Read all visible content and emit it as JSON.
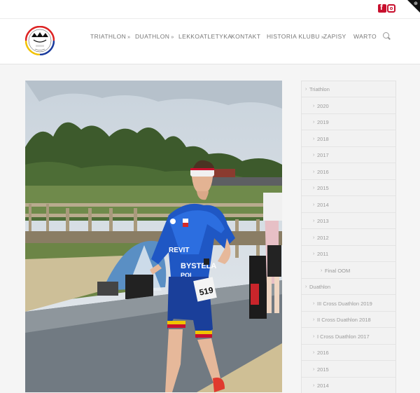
{
  "colors": {
    "brand_red": "#c8102e",
    "nav_text": "#777777",
    "sidebar_text": "#9a9a9a"
  },
  "social": [
    {
      "name": "facebook-icon",
      "glyph": "f"
    },
    {
      "name": "instagram-icon"
    }
  ],
  "corner_badge": {
    "glyph": "⊕"
  },
  "logo": {
    "alt": "Klub logo"
  },
  "nav": {
    "items": [
      {
        "label": "TRIATHLON",
        "has_dropdown": true,
        "chevron": "»"
      },
      {
        "label": "DUATHLON",
        "has_dropdown": true,
        "chevron": "»"
      },
      {
        "label": "LEKKOATLETYKA",
        "has_dropdown": false
      },
      {
        "label": "KONTAKT",
        "has_dropdown": false
      },
      {
        "label": "HISTORIA KLUBU",
        "has_dropdown": true,
        "chevron": "»"
      },
      {
        "label": "ZAPISY",
        "has_dropdown": false
      },
      {
        "label": "WARTO",
        "has_dropdown": false
      }
    ]
  },
  "photo": {
    "bib_number": "519",
    "jersey_text_1": "REVIT",
    "jersey_text_2": "BYSTELA",
    "jersey_text_3": "POL"
  },
  "sidebar": {
    "arrow": "›",
    "items": [
      {
        "label": "Triathlon",
        "level": 0
      },
      {
        "label": "2020",
        "level": 1
      },
      {
        "label": "2019",
        "level": 1
      },
      {
        "label": "2018",
        "level": 1
      },
      {
        "label": "2017",
        "level": 1
      },
      {
        "label": "2016",
        "level": 1
      },
      {
        "label": "2015",
        "level": 1
      },
      {
        "label": "2014",
        "level": 1
      },
      {
        "label": "2013",
        "level": 1
      },
      {
        "label": "2012",
        "level": 1
      },
      {
        "label": "2011",
        "level": 1
      },
      {
        "label": "Final OOM",
        "level": 2
      },
      {
        "label": "Duathlon",
        "level": 0
      },
      {
        "label": "III Cross Duathlon 2019",
        "level": 1
      },
      {
        "label": "II Cross Duathlon 2018",
        "level": 1
      },
      {
        "label": "I Cross Duathlon 2017",
        "level": 1
      },
      {
        "label": "2016",
        "level": 1
      },
      {
        "label": "2015",
        "level": 1
      },
      {
        "label": "2014",
        "level": 1
      }
    ]
  }
}
